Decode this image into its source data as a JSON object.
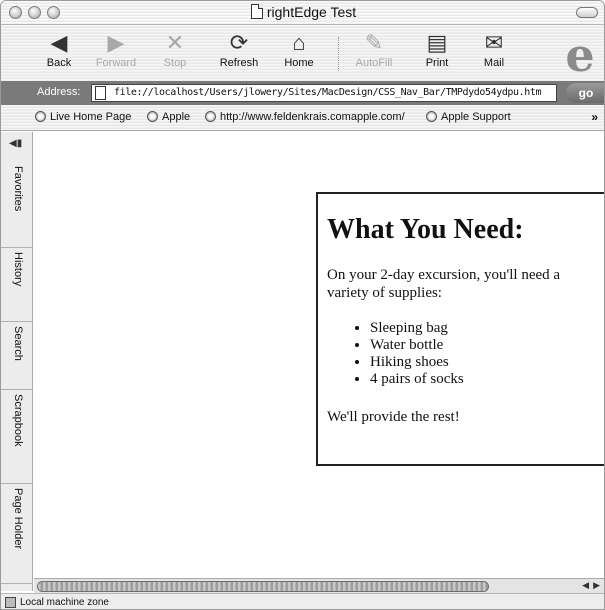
{
  "window": {
    "title": "rightEdge Test"
  },
  "toolbar": {
    "buttons": [
      {
        "label": "Back",
        "icon": "back-arrow-icon",
        "glyph": "◀",
        "enabled": true
      },
      {
        "label": "Forward",
        "icon": "forward-arrow-icon",
        "glyph": "▶",
        "enabled": false
      },
      {
        "label": "Stop",
        "icon": "stop-x-icon",
        "glyph": "✕",
        "enabled": false
      },
      {
        "label": "Refresh",
        "icon": "refresh-icon",
        "glyph": "⟳",
        "enabled": true
      },
      {
        "label": "Home",
        "icon": "home-icon",
        "glyph": "⌂",
        "enabled": true
      },
      {
        "label": "AutoFill",
        "icon": "autofill-icon",
        "glyph": "✎",
        "enabled": false
      },
      {
        "label": "Print",
        "icon": "printer-icon",
        "glyph": "▤",
        "enabled": true
      },
      {
        "label": "Mail",
        "icon": "mail-icon",
        "glyph": "✉",
        "enabled": true
      }
    ],
    "logo": "e"
  },
  "address": {
    "label": "Address:",
    "url": "file://localhost/Users/jlowery/Sites/MacDesign/CSS_Nav_Bar/TMPdydo54ydpu.htm",
    "go_label": "go"
  },
  "favorites": {
    "items": [
      {
        "label": "Live Home Page"
      },
      {
        "label": "Apple"
      },
      {
        "label": "http://www.feldenkrais.comapple.com/"
      },
      {
        "label": "Apple Support"
      }
    ],
    "more": "»"
  },
  "sidebar": {
    "tabs": [
      {
        "label": "Favorites"
      },
      {
        "label": "History"
      },
      {
        "label": "Search"
      },
      {
        "label": "Scrapbook"
      },
      {
        "label": "Page Holder"
      }
    ]
  },
  "page": {
    "heading": "What You Need:",
    "intro": "On your 2-day excursion, you'll need a variety of supplies:",
    "items": [
      "Sleeping bag",
      "Water bottle",
      "Hiking shoes",
      "4 pairs of socks"
    ],
    "closing": "We'll provide the rest!"
  },
  "status": {
    "text": "Local machine zone"
  }
}
